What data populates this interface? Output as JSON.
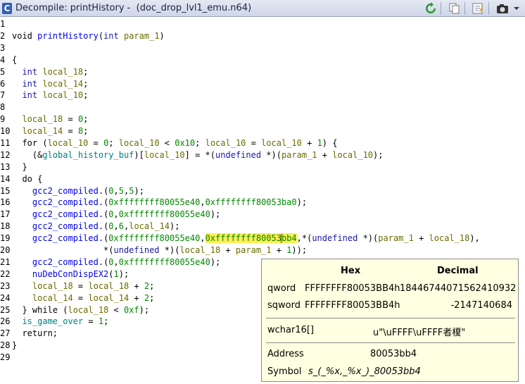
{
  "window": {
    "title": "Decompile: printHistory -  (doc_drop_lvl1_emu.n64)",
    "icon_letter": "C"
  },
  "toolbar": {
    "icons": [
      "refresh-icon",
      "copy-icon",
      "export-icon",
      "snapshot-icon",
      "menu-arrow-icon"
    ]
  },
  "colors": {
    "function": "#0000ee",
    "type": "#1a1aa8",
    "variable": "#6b6b00",
    "global": "#008080",
    "number": "#008a00",
    "highlight": "#ffee55"
  },
  "code_lines": [
    {
      "n": "1",
      "tokens": []
    },
    {
      "n": "2",
      "tokens": [
        [
          "t",
          "void "
        ],
        [
          "f",
          "printHistory"
        ],
        [
          "t",
          "("
        ],
        [
          "y",
          "int "
        ],
        [
          "v",
          "param_1"
        ],
        [
          "t",
          ")"
        ]
      ]
    },
    {
      "n": "3",
      "tokens": []
    },
    {
      "n": "4",
      "tokens": [
        [
          "t",
          "{"
        ]
      ]
    },
    {
      "n": "5",
      "tokens": [
        [
          "t",
          "  "
        ],
        [
          "y",
          "int "
        ],
        [
          "v",
          "local_18"
        ],
        [
          "t",
          ";"
        ]
      ]
    },
    {
      "n": "6",
      "tokens": [
        [
          "t",
          "  "
        ],
        [
          "y",
          "int "
        ],
        [
          "v",
          "local_14"
        ],
        [
          "t",
          ";"
        ]
      ]
    },
    {
      "n": "7",
      "tokens": [
        [
          "t",
          "  "
        ],
        [
          "y",
          "int "
        ],
        [
          "v",
          "local_10"
        ],
        [
          "t",
          ";"
        ]
      ]
    },
    {
      "n": "8",
      "tokens": []
    },
    {
      "n": "9",
      "tokens": [
        [
          "t",
          "  "
        ],
        [
          "v",
          "local_18"
        ],
        [
          "t",
          " = "
        ],
        [
          "u",
          "0"
        ],
        [
          "t",
          ";"
        ]
      ]
    },
    {
      "n": "10",
      "tokens": [
        [
          "t",
          "  "
        ],
        [
          "v",
          "local_14"
        ],
        [
          "t",
          " = "
        ],
        [
          "u",
          "8"
        ],
        [
          "t",
          ";"
        ]
      ]
    },
    {
      "n": "11",
      "tokens": [
        [
          "t",
          "  for ("
        ],
        [
          "v",
          "local_10"
        ],
        [
          "t",
          " = "
        ],
        [
          "u",
          "0"
        ],
        [
          "t",
          "; "
        ],
        [
          "v",
          "local_10"
        ],
        [
          "t",
          " < "
        ],
        [
          "u",
          "0x10"
        ],
        [
          "t",
          "; "
        ],
        [
          "v",
          "local_10"
        ],
        [
          "t",
          " = "
        ],
        [
          "v",
          "local_10"
        ],
        [
          "t",
          " + "
        ],
        [
          "u",
          "1"
        ],
        [
          "t",
          ") {"
        ]
      ]
    },
    {
      "n": "12",
      "tokens": [
        [
          "t",
          "    (&"
        ],
        [
          "g",
          "global_history_buf"
        ],
        [
          "t",
          ")["
        ],
        [
          "v",
          "local_10"
        ],
        [
          "t",
          "] = *("
        ],
        [
          "y",
          "undefined"
        ],
        [
          "t",
          " *)("
        ],
        [
          "v",
          "param_1"
        ],
        [
          "t",
          " + "
        ],
        [
          "v",
          "local_10"
        ],
        [
          "t",
          ");"
        ]
      ]
    },
    {
      "n": "13",
      "tokens": [
        [
          "t",
          "  }"
        ]
      ]
    },
    {
      "n": "14",
      "tokens": [
        [
          "t",
          "  do {"
        ]
      ]
    },
    {
      "n": "15",
      "tokens": [
        [
          "t",
          "    "
        ],
        [
          "f",
          "gcc2_compiled."
        ],
        [
          "t",
          "("
        ],
        [
          "u",
          "0"
        ],
        [
          "t",
          ","
        ],
        [
          "u",
          "5"
        ],
        [
          "t",
          ","
        ],
        [
          "u",
          "5"
        ],
        [
          "t",
          ");"
        ]
      ]
    },
    {
      "n": "16",
      "tokens": [
        [
          "t",
          "    "
        ],
        [
          "f",
          "gcc2_compiled."
        ],
        [
          "t",
          "("
        ],
        [
          "u",
          "0xffffffff80055e40"
        ],
        [
          "t",
          ","
        ],
        [
          "u",
          "0xffffffff80053ba0"
        ],
        [
          "t",
          ");"
        ]
      ]
    },
    {
      "n": "17",
      "tokens": [
        [
          "t",
          "    "
        ],
        [
          "f",
          "gcc2_compiled."
        ],
        [
          "t",
          "("
        ],
        [
          "u",
          "0"
        ],
        [
          "t",
          ","
        ],
        [
          "u",
          "0xffffffff80055e40"
        ],
        [
          "t",
          ");"
        ]
      ]
    },
    {
      "n": "18",
      "tokens": [
        [
          "t",
          "    "
        ],
        [
          "f",
          "gcc2_compiled."
        ],
        [
          "t",
          "("
        ],
        [
          "u",
          "0"
        ],
        [
          "t",
          ","
        ],
        [
          "u",
          "6"
        ],
        [
          "t",
          ","
        ],
        [
          "v",
          "local_14"
        ],
        [
          "t",
          ");"
        ]
      ]
    },
    {
      "n": "19",
      "tokens": [
        [
          "t",
          "    "
        ],
        [
          "f",
          "gcc2_compiled."
        ],
        [
          "t",
          "("
        ],
        [
          "u",
          "0xffffffff80055e40"
        ],
        [
          "t",
          ","
        ],
        [
          "h",
          "0xffffffff80053"
        ],
        [
          "c",
          ""
        ],
        [
          "h",
          "bb4"
        ],
        [
          "t",
          ",*("
        ],
        [
          "y",
          "undefined"
        ],
        [
          "t",
          " *)("
        ],
        [
          "v",
          "param_1"
        ],
        [
          "t",
          " + "
        ],
        [
          "v",
          "local_18"
        ],
        [
          "t",
          "),"
        ]
      ]
    },
    {
      "n": "20",
      "tokens": [
        [
          "t",
          "                  *("
        ],
        [
          "y",
          "undefined"
        ],
        [
          "t",
          " *)("
        ],
        [
          "v",
          "local_18"
        ],
        [
          "t",
          " + "
        ],
        [
          "v",
          "param_1"
        ],
        [
          "t",
          " + "
        ],
        [
          "u",
          "1"
        ],
        [
          "t",
          "));"
        ]
      ]
    },
    {
      "n": "21",
      "tokens": [
        [
          "t",
          "    "
        ],
        [
          "f",
          "gcc2_compiled."
        ],
        [
          "t",
          "("
        ],
        [
          "u",
          "0"
        ],
        [
          "t",
          ","
        ],
        [
          "u",
          "0xffffffff80055e40"
        ],
        [
          "t",
          ");"
        ]
      ]
    },
    {
      "n": "22",
      "tokens": [
        [
          "t",
          "    "
        ],
        [
          "f",
          "nuDebConDispEX2"
        ],
        [
          "t",
          "("
        ],
        [
          "u",
          "1"
        ],
        [
          "t",
          ");"
        ]
      ]
    },
    {
      "n": "23",
      "tokens": [
        [
          "t",
          "    "
        ],
        [
          "v",
          "local_18"
        ],
        [
          "t",
          " = "
        ],
        [
          "v",
          "local_18"
        ],
        [
          "t",
          " + "
        ],
        [
          "u",
          "2"
        ],
        [
          "t",
          ";"
        ]
      ]
    },
    {
      "n": "24",
      "tokens": [
        [
          "t",
          "    "
        ],
        [
          "v",
          "local_14"
        ],
        [
          "t",
          " = "
        ],
        [
          "v",
          "local_14"
        ],
        [
          "t",
          " + "
        ],
        [
          "u",
          "2"
        ],
        [
          "t",
          ";"
        ]
      ]
    },
    {
      "n": "25",
      "tokens": [
        [
          "t",
          "  } while ("
        ],
        [
          "v",
          "local_18"
        ],
        [
          "t",
          " < "
        ],
        [
          "u",
          "0xf"
        ],
        [
          "t",
          ");"
        ]
      ]
    },
    {
      "n": "26",
      "tokens": [
        [
          "t",
          "  "
        ],
        [
          "g",
          "is_game_over"
        ],
        [
          "t",
          " = "
        ],
        [
          "u",
          "1"
        ],
        [
          "t",
          ";"
        ]
      ]
    },
    {
      "n": "27",
      "tokens": [
        [
          "t",
          "  return;"
        ]
      ]
    },
    {
      "n": "28",
      "tokens": [
        [
          "t",
          "}"
        ]
      ]
    },
    {
      "n": "29",
      "tokens": []
    }
  ],
  "tooltip": {
    "header_hex": "Hex",
    "header_decimal": "Decimal",
    "qword_label": "qword",
    "qword_hex": "FFFFFFFF80053BB4h",
    "qword_dec": "18446744071562410932",
    "sqword_label": "sqword",
    "sqword_hex": "FFFFFFFF80053BB4h",
    "sqword_dec": "-2147140684",
    "wchar_label": "wchar16[]",
    "wchar_value": "u\"\\uFFFF\\uFFFF者榎\"",
    "address_label": "Address",
    "address_value": "80053bb4",
    "symbol_label": "Symbol",
    "symbol_value": "s_(_%x,_%x_)_80053bb4"
  }
}
